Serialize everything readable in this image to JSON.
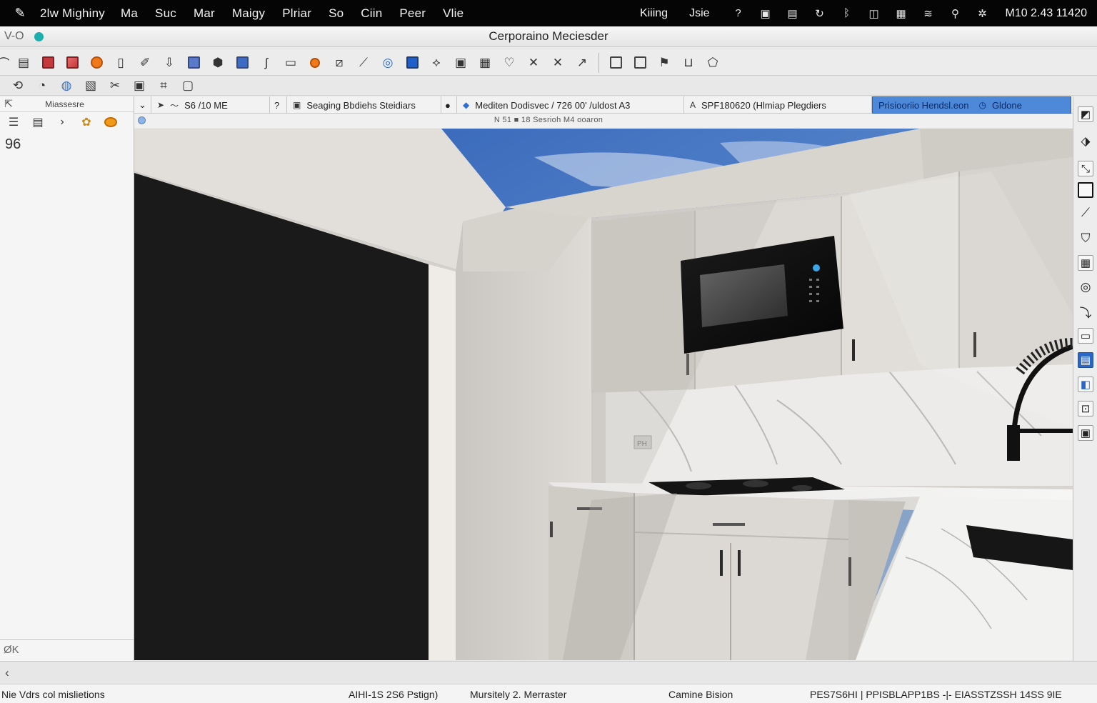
{
  "menubar": {
    "app_name": "2lw Mighiny",
    "items": [
      "Ma",
      "Suc",
      "Mar",
      "Maigy",
      "Plriar",
      "So",
      "Ciin",
      "Peer",
      "Vlie"
    ],
    "right_items": [
      "Kiiing",
      "Jsie"
    ],
    "clock": "M10 2.43 11420"
  },
  "window": {
    "version": "V-O",
    "title": "Cerporaino Meciesder"
  },
  "left_panel": {
    "header": "Miassesre",
    "count": "96",
    "footer": "ØK"
  },
  "tabs": [
    {
      "label": "S6 /10 ME"
    },
    {
      "label": "Seaging Bbdiehs Steidiars"
    },
    {
      "label": "Mediten Dodisvec / 726 00' /uldost A3"
    },
    {
      "label": "SPF180620 (Hlmiap Plegdiers"
    },
    {
      "label": "Prisiooriio Hendsl.eon",
      "extra": "Gldone"
    }
  ],
  "infobar": {
    "text": "N 51 ■ 18 Sesrioh M4 ooaron"
  },
  "viewport": {
    "wall_label": "PH"
  },
  "statusbar": {
    "left": "Nie Vdrs col mislietions",
    "mid1": "AIHI-1S 2S6 Pstign)",
    "mid2": "Mursitely 2. Merraster",
    "mid3": "Camine Bision",
    "right": "PES7S6HI | PPISBLAPP1BS -|- EIASSTZSSH  14SS 9IE"
  }
}
